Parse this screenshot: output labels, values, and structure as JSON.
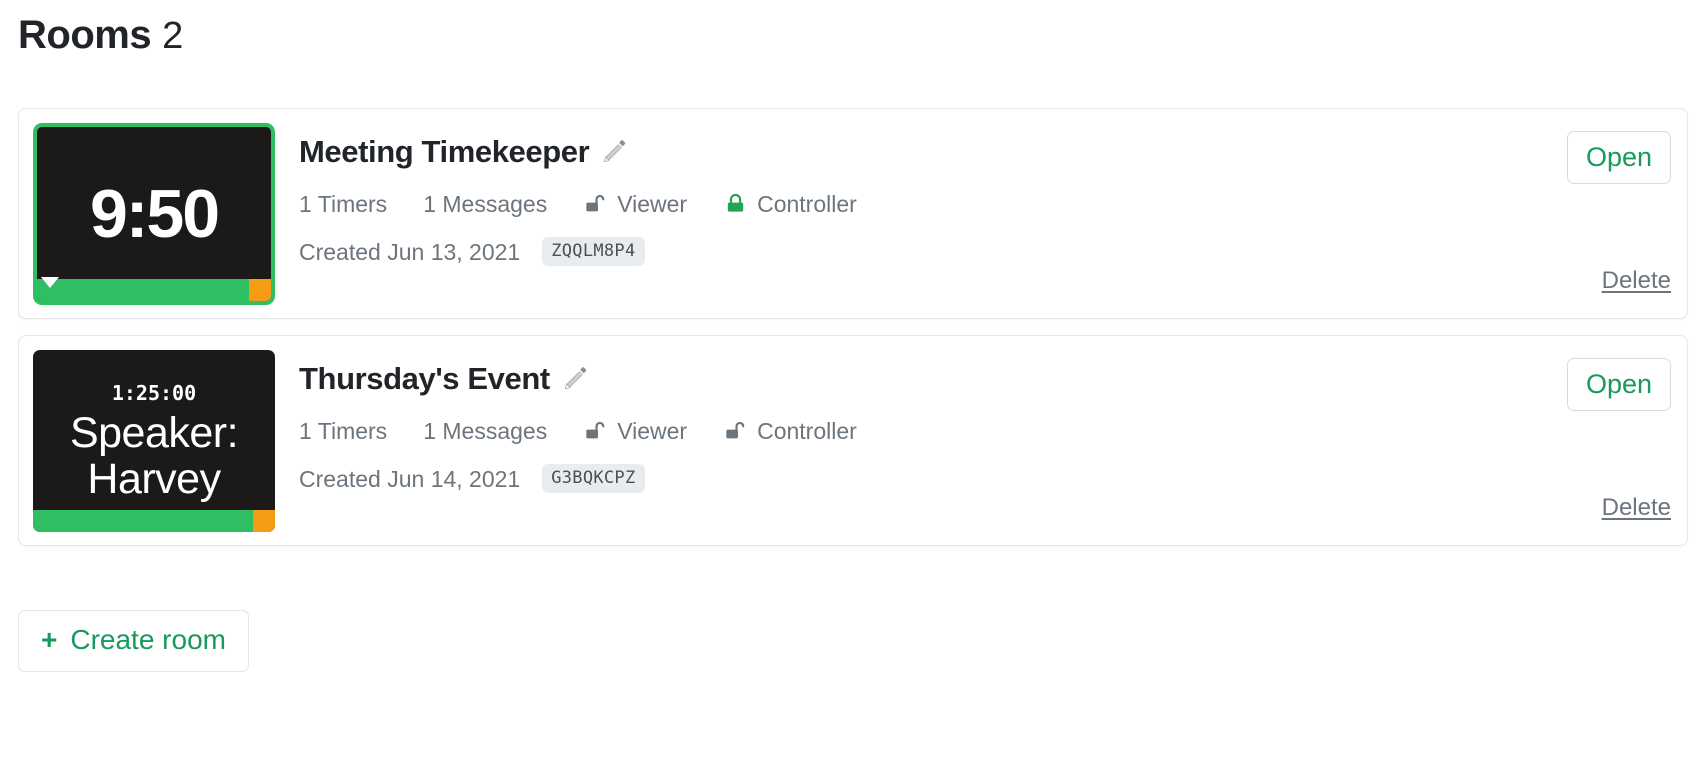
{
  "header": {
    "title": "Rooms",
    "count": "2"
  },
  "rooms": [
    {
      "title": "Meeting Timekeeper",
      "edit_icon": "pencil-icon",
      "thumbnail": {
        "small_clock": "",
        "big_clock": "9:50",
        "big_text": "",
        "highlighted": true,
        "progress_green_color": "#2fbe62",
        "progress_orange_color": "#f59b16",
        "background_color": "#1c1a19"
      },
      "timers": "1 Timers",
      "messages": "1 Messages",
      "viewer": {
        "label": "Viewer",
        "icon": "unlocked-padlock-icon",
        "locked": false,
        "color": "#6c757d"
      },
      "controller": {
        "label": "Controller",
        "icon": "locked-padlock-icon",
        "locked": true,
        "color": "#23a455"
      },
      "created": "Created Jun 13, 2021",
      "code": "ZQQLM8P4",
      "open_label": "Open",
      "delete_label": "Delete"
    },
    {
      "title": "Thursday's Event",
      "edit_icon": "pencil-icon",
      "thumbnail": {
        "small_clock": "1:25:00",
        "big_clock": "",
        "big_text": "Speaker: Harvey",
        "highlighted": false,
        "progress_green_color": "#2fbe62",
        "progress_orange_color": "#f59b16",
        "background_color": "#1c1a19"
      },
      "timers": "1 Timers",
      "messages": "1 Messages",
      "viewer": {
        "label": "Viewer",
        "icon": "unlocked-padlock-icon",
        "locked": false,
        "color": "#6c757d"
      },
      "controller": {
        "label": "Controller",
        "icon": "unlocked-padlock-icon",
        "locked": false,
        "color": "#6c757d"
      },
      "created": "Created Jun 14, 2021",
      "code": "G3BQKCPZ",
      "open_label": "Open",
      "delete_label": "Delete"
    }
  ],
  "create_room": {
    "plus": "+",
    "label": "Create room"
  },
  "colors": {
    "accent_green": "#18995e",
    "bar_green": "#2fbe62",
    "bar_orange": "#f59b16",
    "muted_text": "#6c757d",
    "card_border": "#e6e6e6"
  }
}
